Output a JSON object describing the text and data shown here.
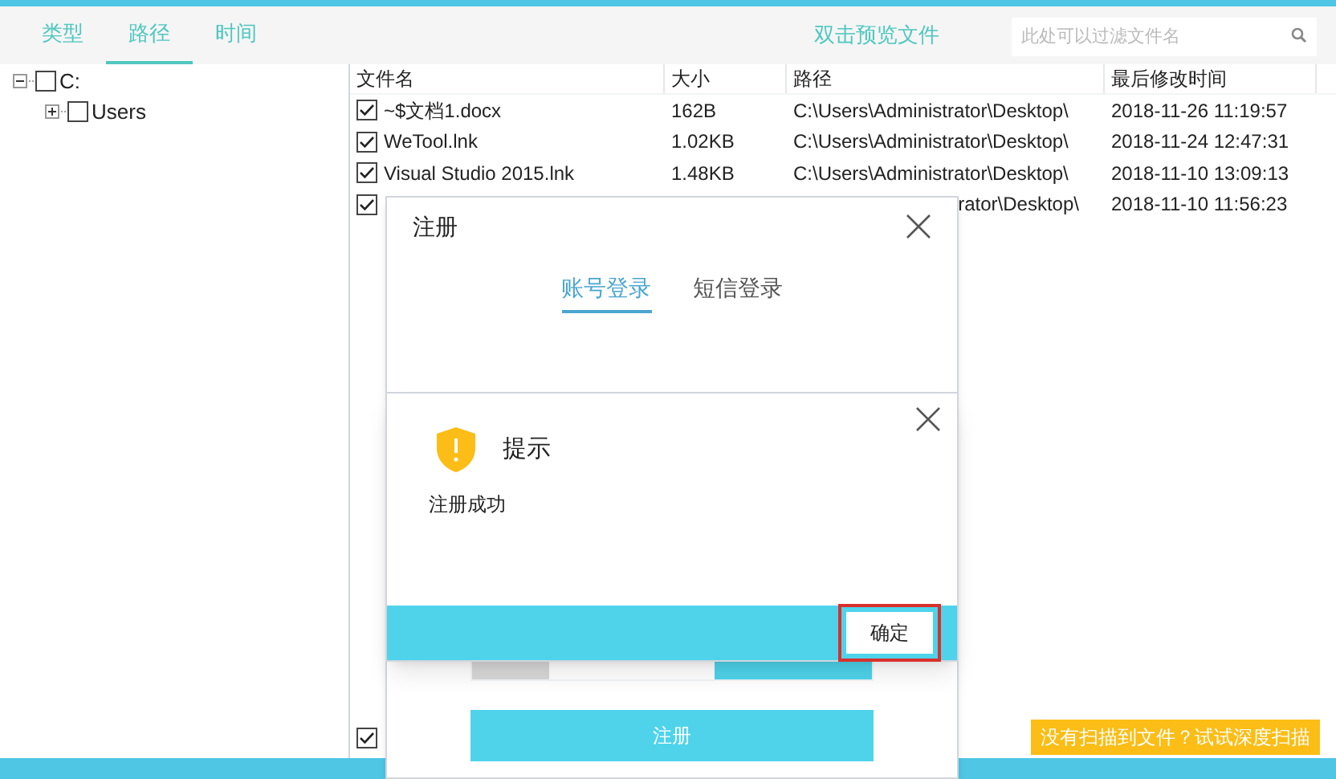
{
  "toolbar": {
    "tabs": [
      {
        "label": "类型",
        "selected": false
      },
      {
        "label": "路径",
        "selected": true
      },
      {
        "label": "时间",
        "selected": false
      }
    ],
    "preview_hint": "双击预览文件",
    "search": {
      "placeholder": "此处可以过滤文件名"
    }
  },
  "tree": [
    {
      "label": "C:",
      "expanded": true,
      "checked": false,
      "children": [
        {
          "label": "Users",
          "expanded": false,
          "checked": false
        }
      ]
    }
  ],
  "table": {
    "columns": [
      "文件名",
      "大小",
      "路径",
      "最后修改时间"
    ],
    "rows": [
      {
        "checked": true,
        "name": "~$文档1.docx",
        "size": "162B",
        "path": "C:\\Users\\Administrator\\Desktop\\",
        "modified": "2018-11-26 11:19:57"
      },
      {
        "checked": true,
        "name": "WeTool.lnk",
        "size": "1.02KB",
        "path": "C:\\Users\\Administrator\\Desktop\\",
        "modified": "2018-11-24 12:47:31"
      },
      {
        "checked": true,
        "name": "Visual Studio 2015.lnk",
        "size": "1.48KB",
        "path": "C:\\Users\\Administrator\\Desktop\\",
        "modified": "2018-11-10 13:09:13"
      },
      {
        "checked": true,
        "path": "rator\\Desktop\\",
        "modified": "2018-11-10 11:56:23"
      }
    ]
  },
  "footer": {
    "select_all": {
      "checked": true
    },
    "deep_scan_button": "没有扫描到文件？试试深度扫描"
  },
  "register_dialog": {
    "title": "注册",
    "tabs": [
      {
        "label": "账号登录",
        "selected": true
      },
      {
        "label": "短信登录",
        "selected": false
      }
    ],
    "submit_button": "注册"
  },
  "alert_dialog": {
    "title": "提示",
    "message": "注册成功",
    "ok_button": "确定",
    "highlighted": true
  }
}
